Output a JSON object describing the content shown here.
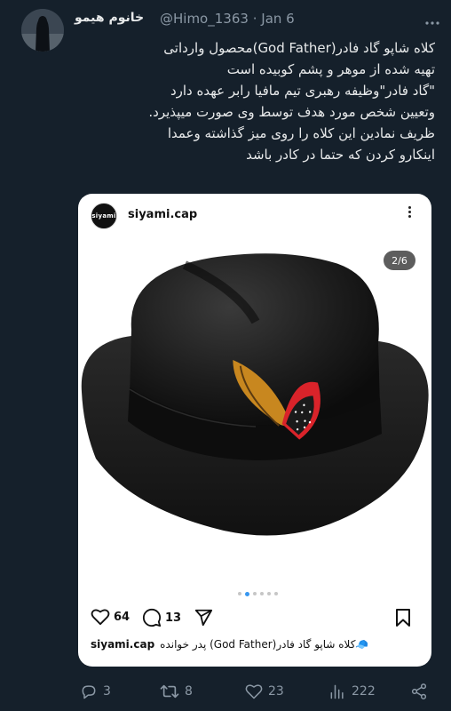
{
  "author": {
    "display_name": "خانوم هیمو",
    "handle": "@Himo_1363",
    "separator": "·",
    "date": "Jan 6"
  },
  "tweet": {
    "lines": [
      "کلاه شاپو گاد فادر(God Father)محصول وارداتی",
      "تهیه شده از موهر و پشم کوبیده است",
      "\"گاد فادر\"وظیفه رهبری تیم مافیا رابر عهده دارد",
      "وتعیین شخص مورد هدف توسط وی صورت میپذیرد.",
      "ظریف نمادین این کلاه را روی میز گذاشته وعمدا",
      "اینکارو کردن که حتما در کادر باشد"
    ]
  },
  "instagram": {
    "logo_text": "siyami",
    "username": "siyami.cap",
    "image_counter": "2/6",
    "likes": "64",
    "comments": "13",
    "caption_user": "siyami.cap",
    "caption_text": "🧢کلاه شاپو گاد  فادر(God Father) پدر خوانده"
  },
  "actions": {
    "replies": "3",
    "reposts": "8",
    "likes": "23",
    "views": "222"
  },
  "colors": {
    "background": "#15202b",
    "text": "#e7e9ea",
    "muted": "#8b98a5",
    "ig_accent": "#3897f0",
    "feather_red": "#d9232a"
  }
}
